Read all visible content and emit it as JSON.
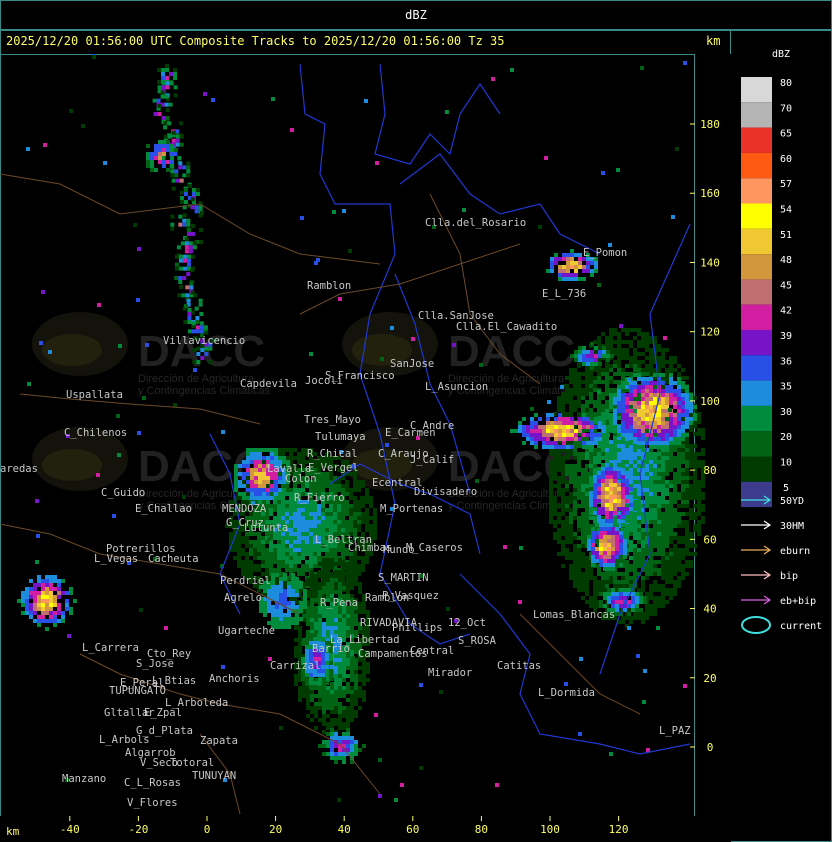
{
  "header": {
    "title": "dBZ"
  },
  "subtitle": "2025/12/20 01:56:00 UTC Composite Tracks to 2025/12/20 01:56:00 Tz 35",
  "axis": {
    "unit": "km",
    "x_ticks": [
      "-40",
      "-20",
      "0",
      "20",
      "40",
      "60",
      "80",
      "100",
      "120"
    ],
    "y_ticks": [
      "180",
      "160",
      "140",
      "120",
      "100",
      "80",
      "60",
      "40",
      "20",
      "0"
    ]
  },
  "watermark": {
    "text": "DACC",
    "line1": "Dirección de Agricultura",
    "line2": "y Contingencias Climáticas"
  },
  "legend": {
    "title": "dBZ",
    "scale": [
      {
        "label": "80",
        "color": "#d8d8d8"
      },
      {
        "label": "70",
        "color": "#b4b4b4"
      },
      {
        "label": "65",
        "color": "#e8322a"
      },
      {
        "label": "60",
        "color": "#ff5a14"
      },
      {
        "label": "57",
        "color": "#ff9660"
      },
      {
        "label": "54",
        "color": "#ffff00"
      },
      {
        "label": "51",
        "color": "#f0c832"
      },
      {
        "label": "48",
        "color": "#d2963c"
      },
      {
        "label": "45",
        "color": "#c07070"
      },
      {
        "label": "42",
        "color": "#d21ea0"
      },
      {
        "label": "39",
        "color": "#7814c8"
      },
      {
        "label": "36",
        "color": "#2850e6"
      },
      {
        "label": "35",
        "color": "#1e8cdc"
      },
      {
        "label": "30",
        "color": "#008c3c"
      },
      {
        "label": "20",
        "color": "#006414"
      },
      {
        "label": "10",
        "color": "#003c00"
      },
      {
        "label": "5",
        "color": "#3c3c8c"
      }
    ],
    "tracks": [
      {
        "label": "50YD",
        "color": "#40e0e0"
      },
      {
        "label": "30HM",
        "color": "#ffffff"
      },
      {
        "label": "eburn",
        "color": "#f0b060"
      },
      {
        "label": "bip",
        "color": "#ffc0c0"
      },
      {
        "label": "eb+bip",
        "color": "#e060e0"
      },
      {
        "label": "current",
        "color": "#40e0e0"
      }
    ]
  },
  "places": [
    "Clla.del_Rosario",
    "Ramblon",
    "Clla.SanJose",
    "Clla.El_Cawadito",
    "Villavicencio",
    "Capdevila",
    "S_Francisco",
    "SanJose",
    "L_Asuncion",
    "Uspallata",
    "Jocoli",
    "Tres_Mayo",
    "Tulumaya",
    "E_Carmen",
    "C_Andre",
    "C_Chilenos",
    "C_Araujo",
    "J_Calif",
    "R_Chical",
    "E_Vergel",
    "Lavalle",
    "Colon",
    "Ecentral",
    "Divisadero",
    "C_Guido",
    "E_Challao",
    "R_Fierro",
    "M_Portenas",
    "MENDOZA",
    "G_Cruz",
    "Lulunta",
    "L_Beltran",
    "Chimbas",
    "Mundo",
    "M_Caseros",
    "Potrerillos",
    "L_Vegas",
    "Cacheuta",
    "S_MARTIN",
    "Perdriel",
    "Agrelo",
    "P_Vasquez",
    "Ramblon",
    "R_Pena",
    "RIVADAVIA",
    "12_Oct",
    "Phillips",
    "S_ROSA",
    "Lomas_Blancas",
    "Ugarteche",
    "L_Carrera",
    "Cto_Rey",
    "S_Jose",
    "Barrio",
    "La_Libertad",
    "Campamentos",
    "Central",
    "Catitas",
    "Carrizal",
    "E_Peral",
    "L_Btias",
    "Anchoris",
    "TUPUNGATO",
    "Mirador",
    "L_Arboleda",
    "Gltallar",
    "E_Zpal",
    "L_Dormida",
    "G_d_Plata",
    "L_Arbols",
    "Zapata",
    "L_PAZ",
    "Algarrob",
    "V_Seco",
    "Totoral",
    "TUNUYAN",
    "Manzano",
    "C_L_Rosas",
    "V_Flores",
    "E_Pomon",
    "E_L_736",
    "aredas"
  ]
}
